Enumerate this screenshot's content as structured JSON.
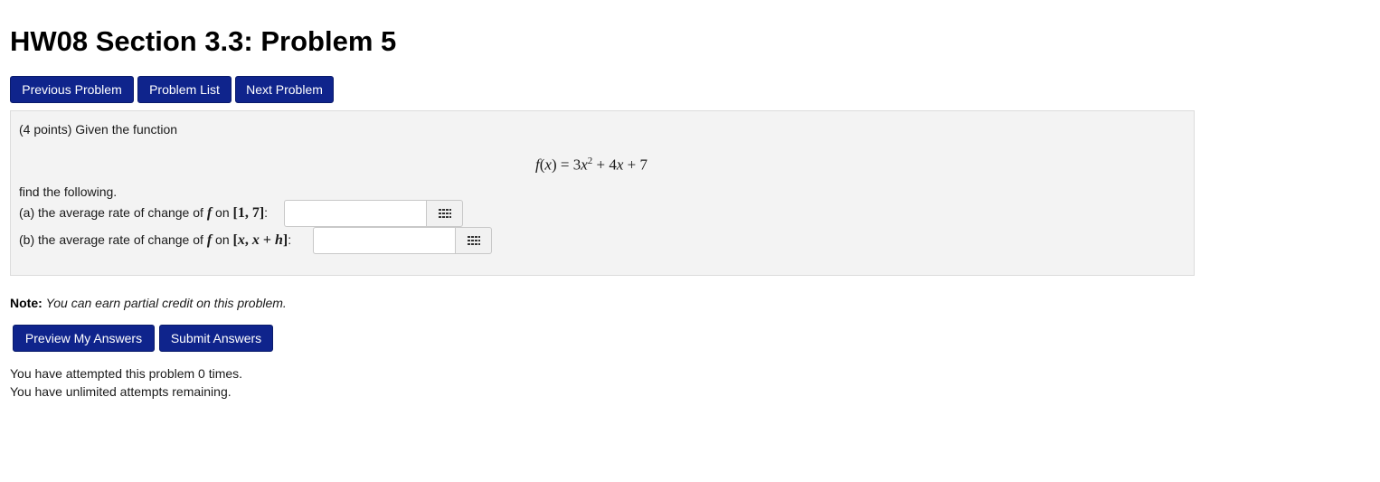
{
  "page": {
    "title": "HW08 Section 3.3: Problem 5"
  },
  "nav": {
    "previous_label": "Previous Problem",
    "list_label": "Problem List",
    "next_label": "Next Problem"
  },
  "problem": {
    "intro": "(4 points) Given the function",
    "formula": {
      "lhs_f": "f",
      "lhs_x": "x",
      "eq": "=",
      "coef1": "3",
      "var1": "x",
      "exp1": "2",
      "plus1": "+",
      "term2": "4",
      "var2": "x",
      "plus2": "+",
      "const": "7"
    },
    "find_text": "find the following.",
    "part_a": {
      "prefix": "(a) the average rate of change of",
      "func": "f",
      "on": "on",
      "interval": "[1, 7]",
      "colon": ":",
      "value": "",
      "placeholder": ""
    },
    "part_b": {
      "prefix": "(b) the average rate of change of",
      "func": "f",
      "on": "on",
      "interval_open": "[",
      "interval_x1": "x",
      "interval_comma": ", ",
      "interval_x2": "x",
      "interval_plus": " + ",
      "interval_h": "h",
      "interval_close": "]",
      "colon": ":",
      "value": "",
      "placeholder": ""
    },
    "icons": {
      "equation_editor": "grid-icon"
    }
  },
  "note": {
    "label": "Note:",
    "text": "You can earn partial credit on this problem."
  },
  "actions": {
    "preview_label": "Preview My Answers",
    "submit_label": "Submit Answers"
  },
  "status": {
    "attempts_text": "You have attempted this problem 0 times.",
    "remaining_text": "You have unlimited attempts remaining."
  },
  "colors": {
    "button_bg": "#0f248c",
    "panel_bg": "#f3f3f3"
  }
}
